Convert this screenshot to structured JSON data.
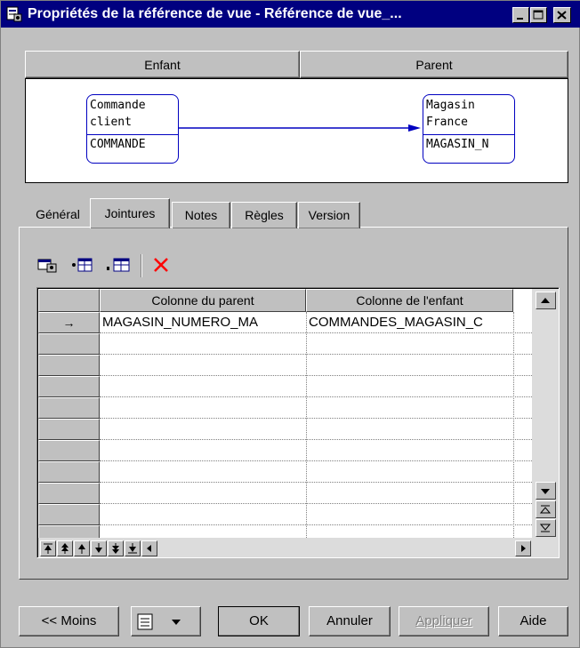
{
  "window": {
    "title": "Propriétés de la référence de vue - Référence de vue_...",
    "controls": [
      "minimize-icon",
      "maximize-icon",
      "close-icon"
    ]
  },
  "header": {
    "child_label": "Enfant",
    "parent_label": "Parent"
  },
  "diagram": {
    "child_entity": {
      "name": "Commande\nclient",
      "column": "COMMANDE"
    },
    "parent_entity": {
      "name": "Magasin\nFrance",
      "column": "MAGASIN_N"
    },
    "link_color": "#0000c0"
  },
  "tabs": [
    {
      "label": "Général",
      "active": false
    },
    {
      "label": "Jointures",
      "active": true
    },
    {
      "label": "Notes",
      "active": false
    },
    {
      "label": "Règles",
      "active": false
    },
    {
      "label": "Version",
      "active": false
    }
  ],
  "toolbar": {
    "icons": [
      "properties-icon",
      "insert-row-icon",
      "add-row-icon",
      "delete-icon"
    ],
    "delete_color": "#ff0000"
  },
  "grid": {
    "columns": [
      "Colonne du parent",
      "Colonne de l'enfant"
    ],
    "rows": [
      {
        "marker": "→",
        "parent": "MAGASIN_NUMERO_MA",
        "child": "COMMANDES_MAGASIN_C"
      },
      {
        "marker": "",
        "parent": "",
        "child": ""
      },
      {
        "marker": "",
        "parent": "",
        "child": ""
      },
      {
        "marker": "",
        "parent": "",
        "child": ""
      },
      {
        "marker": "",
        "parent": "",
        "child": ""
      },
      {
        "marker": "",
        "parent": "",
        "child": ""
      },
      {
        "marker": "",
        "parent": "",
        "child": ""
      },
      {
        "marker": "",
        "parent": "",
        "child": ""
      },
      {
        "marker": "",
        "parent": "",
        "child": ""
      },
      {
        "marker": "",
        "parent": "",
        "child": ""
      },
      {
        "marker": "",
        "parent": "",
        "child": ""
      }
    ],
    "nav_icons": [
      "move-top-icon",
      "move-page-up-icon",
      "move-up-icon",
      "move-down-icon",
      "move-page-down-icon",
      "move-bottom-icon"
    ]
  },
  "buttons": {
    "less": "<< Moins",
    "ok": "OK",
    "cancel": "Annuler",
    "apply": "Appliquer",
    "help": "Aide"
  }
}
